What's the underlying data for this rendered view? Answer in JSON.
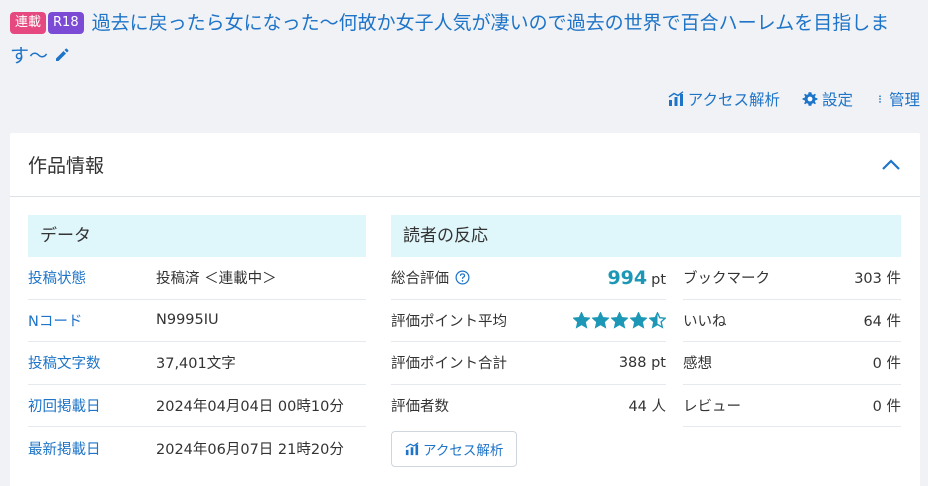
{
  "title": {
    "badge_serial": "連載",
    "badge_r18": "R18",
    "text": "過去に戻ったら女になった〜何故か女子人気が凄いので過去の世界で百合ハーレムを目指します〜"
  },
  "actions": {
    "access": "アクセス解析",
    "settings": "設定",
    "manage": "管理"
  },
  "card": {
    "title": "作品情報"
  },
  "data_section": {
    "heading": "データ",
    "rows": [
      {
        "key": "投稿状態",
        "value": "投稿済 ＜連載中＞"
      },
      {
        "key": "Nコード",
        "value": "N9995IU"
      },
      {
        "key": "投稿文字数",
        "value": "37,401文字"
      },
      {
        "key": "初回掲載日",
        "value": "2024年04月04日 00時10分"
      },
      {
        "key": "最新掲載日",
        "value": "2024年06月07日 21時20分"
      }
    ]
  },
  "reaction_section": {
    "heading": "読者の反応",
    "total": {
      "key": "総合評価",
      "value": "994",
      "unit": "pt"
    },
    "avg": {
      "key": "評価ポイント平均",
      "stars": 4.5
    },
    "sum": {
      "key": "評価ポイント合計",
      "value": "388 pt"
    },
    "raters": {
      "key": "評価者数",
      "value": "44 人"
    },
    "access_button": "アクセス解析",
    "right": [
      {
        "key": "ブックマーク",
        "value": "303 件"
      },
      {
        "key": "いいね",
        "value": "64 件"
      },
      {
        "key": "感想",
        "value": "0 件"
      },
      {
        "key": "レビュー",
        "value": "0 件"
      }
    ]
  },
  "colors": {
    "link": "#1e74c8",
    "badge_serial": "#e5497f",
    "badge_r18": "#7b4bd6",
    "section_bg": "#dff6fa",
    "star": "#1c98b6"
  }
}
